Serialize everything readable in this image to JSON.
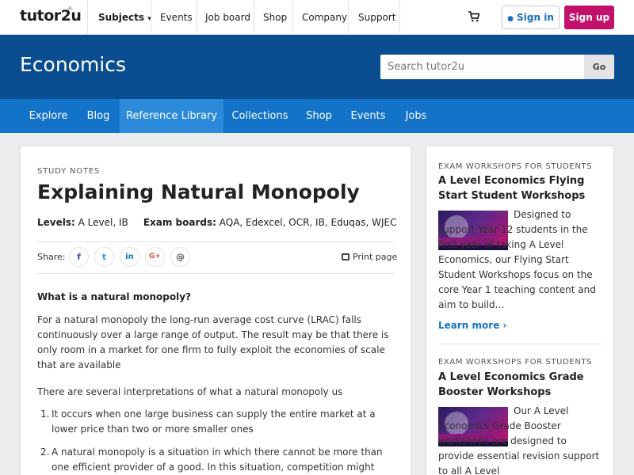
{
  "topbar": {
    "logo": "tutor2u",
    "nav": [
      {
        "label": "Subjects",
        "bold": true
      },
      {
        "label": "Events"
      },
      {
        "label": "Job board"
      },
      {
        "label": "Shop"
      },
      {
        "label": "Company"
      },
      {
        "label": "Support"
      }
    ],
    "signin": "Sign in",
    "signup": "Sign up"
  },
  "header": {
    "title": "Economics",
    "search_placeholder": "Search tutor2u",
    "search_button": "Go"
  },
  "subnav": [
    {
      "label": "Explore"
    },
    {
      "label": "Blog"
    },
    {
      "label": "Reference Library",
      "active": true
    },
    {
      "label": "Collections"
    },
    {
      "label": "Shop"
    },
    {
      "label": "Events"
    },
    {
      "label": "Jobs"
    }
  ],
  "article": {
    "kicker": "STUDY NOTES",
    "title": "Explaining Natural Monopoly",
    "levels_label": "Levels:",
    "levels_value": "A Level, IB",
    "boards_label": "Exam boards:",
    "boards_value": "AQA, Edexcel, OCR, IB, Eduqas, WJEC",
    "share_label": "Share:",
    "share_buttons": [
      "f",
      "t",
      "in",
      "G+",
      "@"
    ],
    "print_label": "Print page",
    "question": "What is a natural monopoly?",
    "para1": "For a natural monopoly the long-run average cost curve (LRAC) falls continuously over a large range of output. The result may be that there is only room in a market for one firm to fully exploit the economies of scale that are available",
    "para2": "There are several interpretations of what a natural monopoly us",
    "list": [
      {
        "num": "1.",
        "text": "It occurs when one large business can supply the entire market at a lower price than two or more smaller ones"
      },
      {
        "num": "2.",
        "text": "A natural monopoly is a situation in which there cannot be more than one efficient provider of a good. In this situation, competition might actually"
      }
    ]
  },
  "sidebar": [
    {
      "kicker": "EXAM WORKSHOPS FOR STUDENTS",
      "title": "A Level Economics Flying Start Student Workshops",
      "text": "Designed to support Year 12 students in the first year of taking A Level Economics, our Flying Start Student Workshops focus on the core Year 1 teaching content and aim to build…",
      "link": "Learn more ›"
    },
    {
      "kicker": "EXAM WORKSHOPS FOR STUDENTS",
      "title": "A Level Economics Grade Booster Workshops",
      "text": "Our A Level Economics Grade Booster workshops are designed to provide essential revision support to all A Level"
    }
  ],
  "colors": {
    "header_blue": "#0a4e91",
    "subnav_blue": "#1273c9",
    "signup_magenta": "#c3106b"
  }
}
